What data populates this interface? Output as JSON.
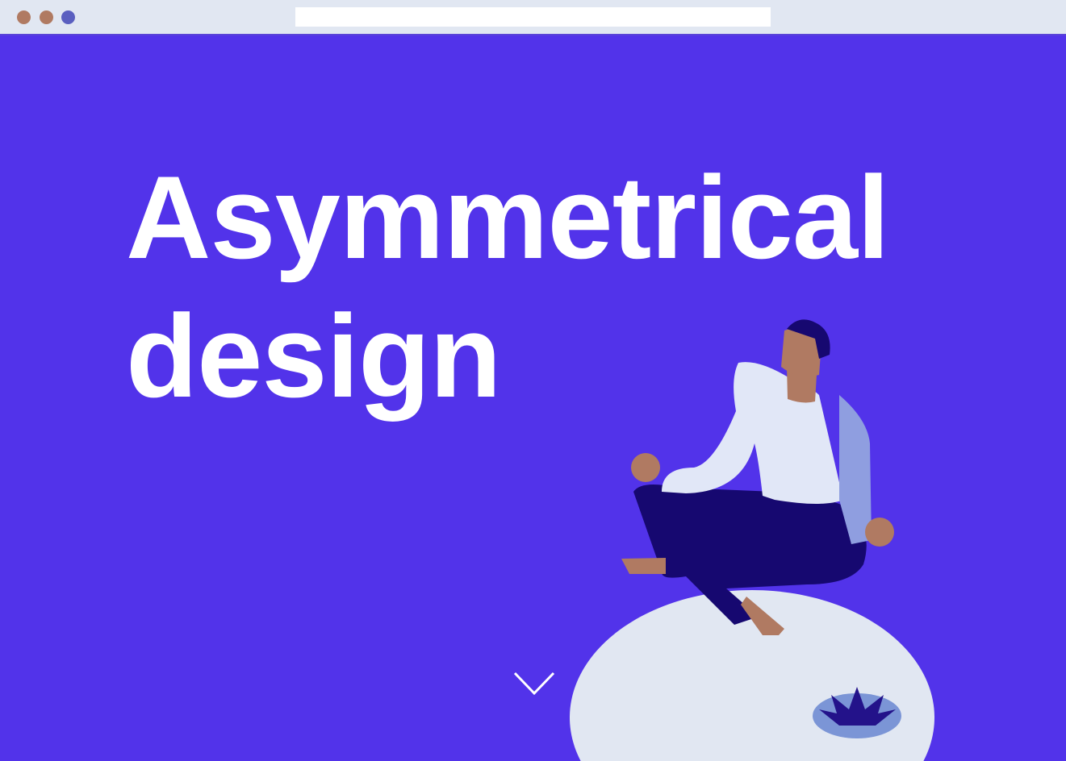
{
  "browser": {
    "url": ""
  },
  "hero": {
    "title_line1": "Asymmetrical",
    "title_line2": "design"
  },
  "colors": {
    "background": "#5233ea",
    "chrome": "#e1e7f2",
    "skin": "#b07a62",
    "pants": "#160870",
    "shirt": "#e1e7f7"
  }
}
